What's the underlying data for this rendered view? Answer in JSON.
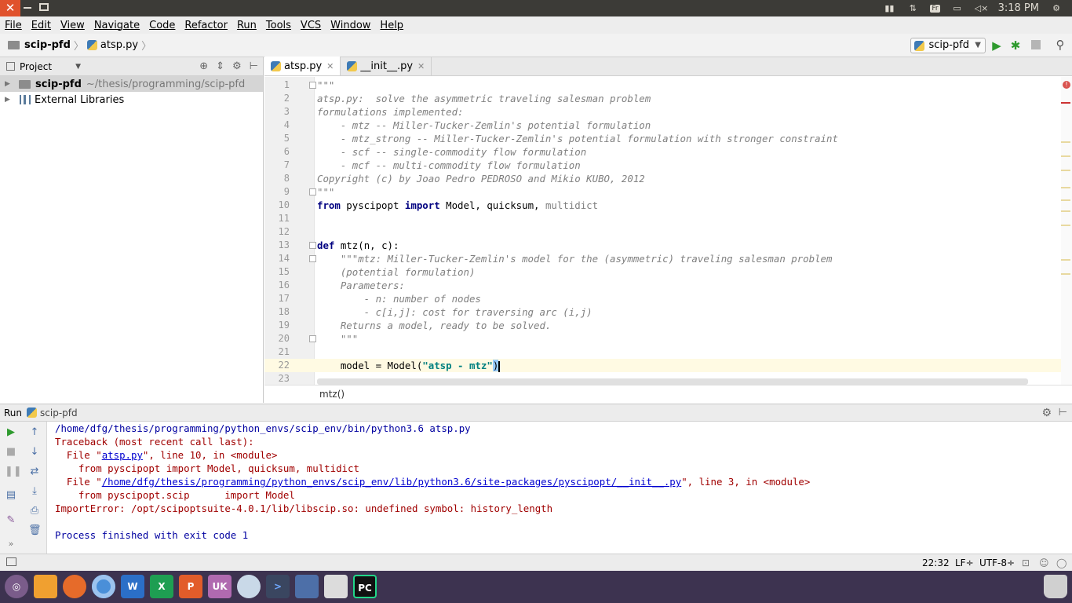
{
  "system_bar": {
    "keyboard": "Fr",
    "time": "3:18 PM"
  },
  "menu": [
    "File",
    "Edit",
    "View",
    "Navigate",
    "Code",
    "Refactor",
    "Run",
    "Tools",
    "VCS",
    "Window",
    "Help"
  ],
  "navbar": {
    "project": "scip-pfd",
    "file": "atsp.py",
    "run_config": "scip-pfd"
  },
  "project_panel": {
    "title": "Project",
    "root_name": "scip-pfd",
    "root_path": "~/thesis/programming/scip-pfd",
    "external": "External Libraries"
  },
  "tabs": [
    {
      "label": "atsp.py",
      "active": true
    },
    {
      "label": "__init__.py",
      "active": false
    }
  ],
  "code": {
    "l1": "\"\"\"",
    "l2": "atsp.py:  solve the asymmetric traveling salesman problem",
    "l3": "formulations implemented:",
    "l4": "    - mtz -- Miller-Tucker-Zemlin's potential formulation",
    "l5": "    - mtz_strong -- Miller-Tucker-Zemlin's potential formulation with stronger constraint",
    "l6": "    - scf -- single-commodity flow formulation",
    "l7": "    - mcf -- multi-commodity flow formulation",
    "l8": "Copyright (c) by Joao Pedro PEDROSO and Mikio KUBO, 2012",
    "l9": "\"\"\"",
    "l10_from": "from",
    "l10_mod": " pyscipopt ",
    "l10_import": "import",
    "l10_names": " Model, quicksum, ",
    "l10_unused": "multidict",
    "l13_def": "def",
    "l13_rest": " mtz(n, c):",
    "l14": "    \"\"\"mtz: Miller-Tucker-Zemlin's model for the (asymmetric) traveling salesman problem",
    "l15": "    (potential formulation)",
    "l16": "    Parameters:",
    "l17": "        - n: number of nodes",
    "l18": "        - c[i,j]: cost for traversing arc (i,j)",
    "l19": "    Returns a model, ready to be solved.",
    "l20": "    \"\"\"",
    "l22_a": "    model = Model(",
    "l22_str": "\"atsp - mtz\"",
    "l22_b": ")",
    "breadcrumb": "mtz()"
  },
  "run_panel": {
    "label": "Run",
    "config": "scip-pfd",
    "lines": {
      "cmd": "/home/dfg/thesis/programming/python_envs/scip_env/bin/python3.6 atsp.py",
      "tb": "Traceback (most recent call last):",
      "f1_pre": "  File \"",
      "f1_link": "atsp.py",
      "f1_post": "\", line 10, in <module>",
      "f1_code": "    from pyscipopt import Model, quicksum, multidict",
      "f2_pre": "  File \"",
      "f2_link": "/home/dfg/thesis/programming/python_envs/scip_env/lib/python3.6/site-packages/pyscipopt/__init__.py",
      "f2_post": "\", line 3, in <module>",
      "f2_code": "    from pyscipopt.scip      import Model",
      "err": "ImportError: /opt/scipoptsuite-4.0.1/lib/libscip.so: undefined symbol: history_length",
      "exit": "Process finished with exit code 1"
    }
  },
  "status": {
    "position": "22:32",
    "line_sep": "LF",
    "encoding": "UTF-8"
  },
  "dock": [
    "ubuntu-icon",
    "files-icon",
    "firefox-icon",
    "chromium-icon",
    "word-icon",
    "excel-icon",
    "powerpoint-icon",
    "store-icon",
    "network-icon",
    "terminal-icon",
    "screenshot-icon",
    "display-icon",
    "pycharm-icon",
    "trash-icon"
  ]
}
